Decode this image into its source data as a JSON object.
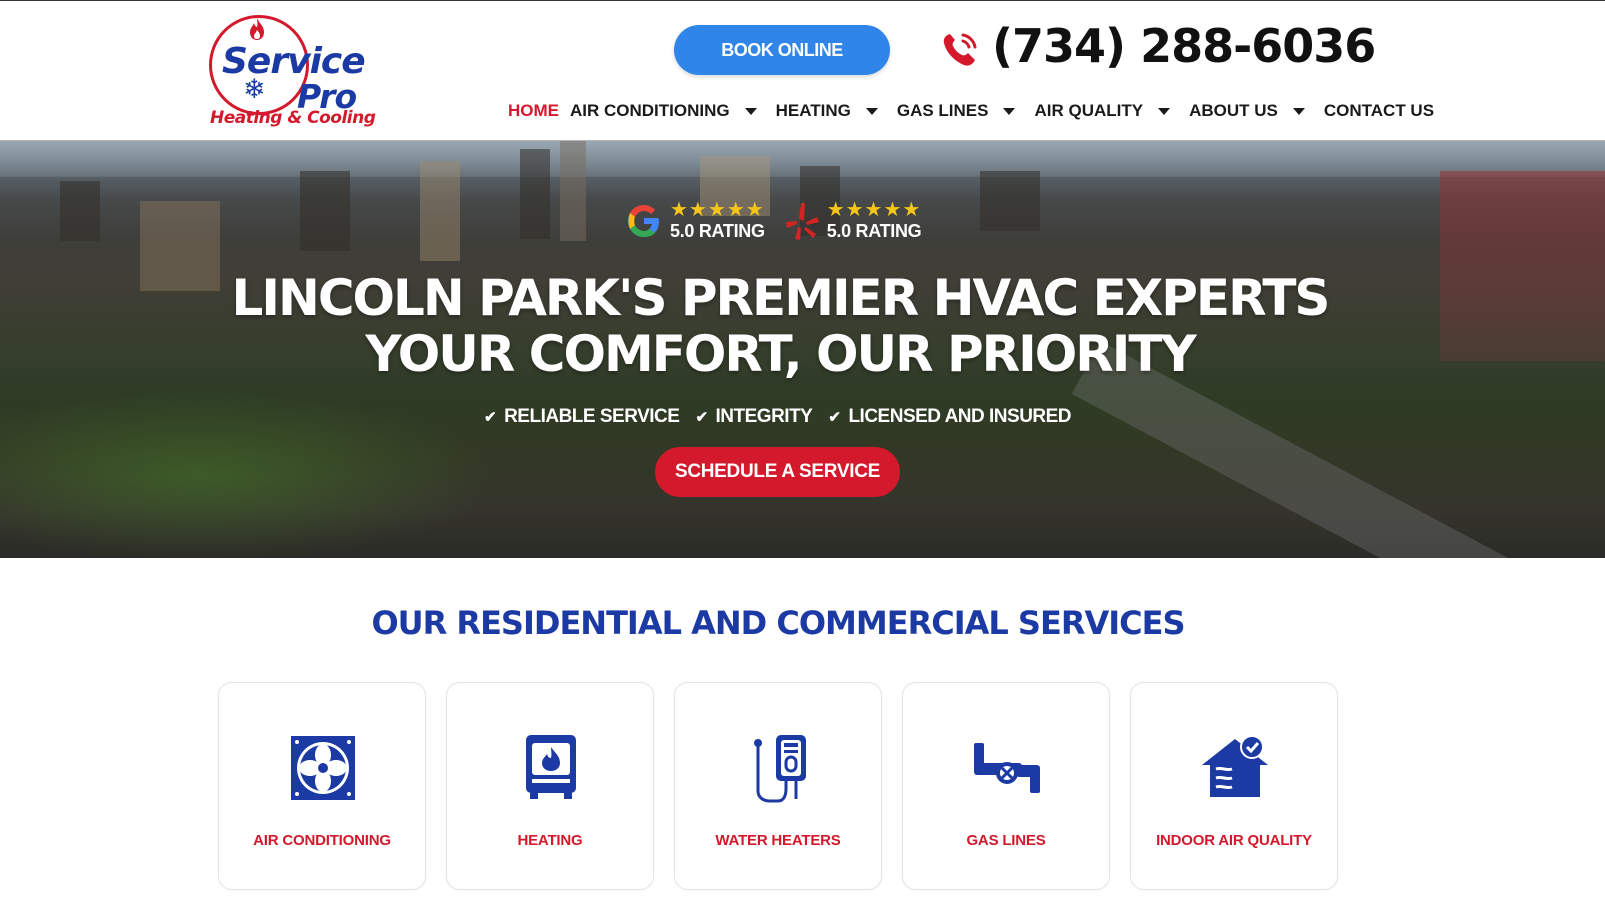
{
  "header": {
    "logo": {
      "word1": "Service",
      "word2": "Pro",
      "tagline": "Heating & Cooling"
    },
    "book_button": "BOOK ONLINE",
    "phone": "(734) 288-6036",
    "nav": [
      {
        "label": "HOME",
        "active": true,
        "dropdown": false
      },
      {
        "label": "AIR CONDITIONING",
        "active": false,
        "dropdown": true
      },
      {
        "label": "HEATING",
        "active": false,
        "dropdown": true
      },
      {
        "label": "GAS LINES",
        "active": false,
        "dropdown": true
      },
      {
        "label": "AIR QUALITY",
        "active": false,
        "dropdown": true
      },
      {
        "label": "ABOUT US",
        "active": false,
        "dropdown": true
      },
      {
        "label": "CONTACT US",
        "active": false,
        "dropdown": false
      }
    ]
  },
  "hero": {
    "ratings": [
      {
        "source_icon": "google-icon",
        "stars": "★★★★★",
        "label": "5.0 RATING"
      },
      {
        "source_icon": "yelp-icon",
        "stars": "★★★★★",
        "label": "5.0 RATING"
      }
    ],
    "headline_line1": "LINCOLN PARK'S PREMIER HVAC EXPERTS",
    "headline_line2": "YOUR COMFORT, OUR PRIORITY",
    "checks": [
      "RELIABLE SERVICE",
      "INTEGRITY",
      "LICENSED AND INSURED"
    ],
    "cta": "SCHEDULE A SERVICE"
  },
  "services": {
    "title": "OUR RESIDENTIAL AND COMMERCIAL SERVICES",
    "cards": [
      {
        "label": "AIR CONDITIONING",
        "icon": "fan-unit-icon"
      },
      {
        "label": "HEATING",
        "icon": "furnace-icon"
      },
      {
        "label": "WATER HEATERS",
        "icon": "water-heater-icon"
      },
      {
        "label": "GAS LINES",
        "icon": "gas-pipe-icon"
      },
      {
        "label": "INDOOR AIR QUALITY",
        "icon": "house-air-icon"
      }
    ]
  },
  "colors": {
    "brand_red": "#d3192b",
    "brand_blue": "#1c3aa3",
    "book_button_blue": "#2f86e8",
    "star_gold": "#f5c518"
  }
}
